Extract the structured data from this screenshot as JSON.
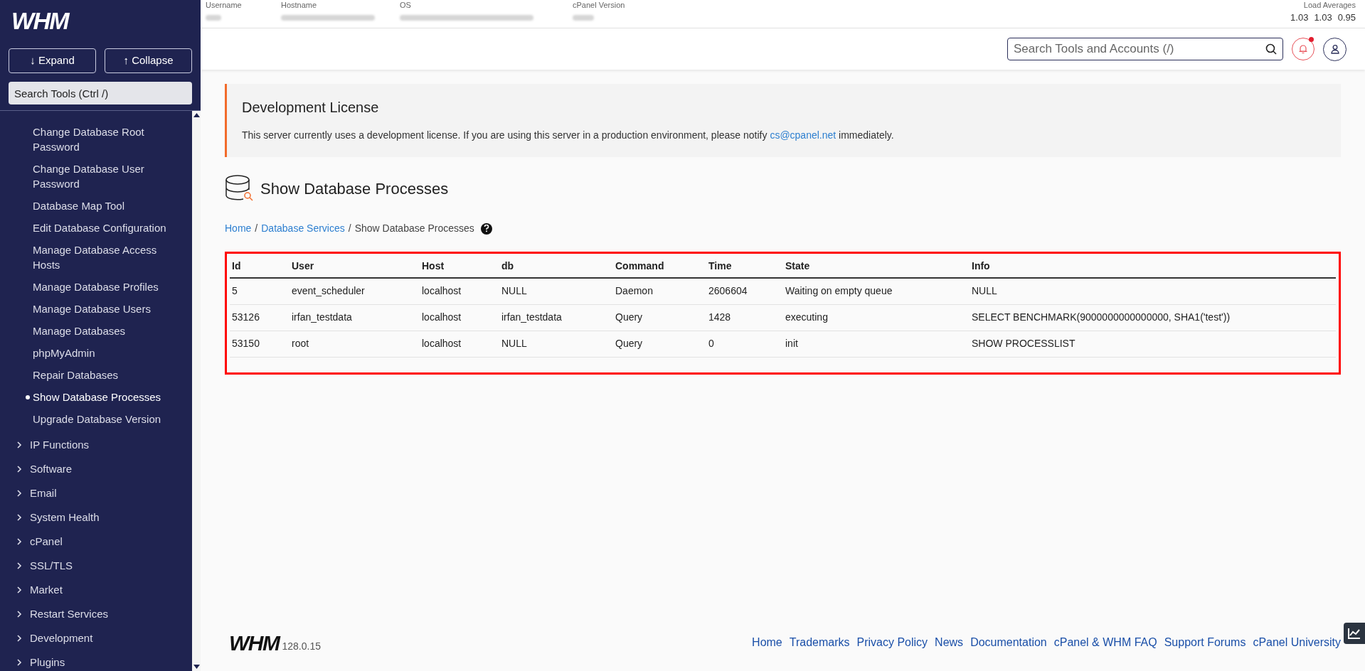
{
  "sidebar": {
    "logo": "WHM",
    "expand_button": "↓ Expand",
    "collapse_button": "↑ Collapse",
    "search": {
      "placeholder": "Search Tools (Ctrl /)"
    },
    "subitems": [
      {
        "label": "Change Database Root Password",
        "selected": false
      },
      {
        "label": "Change Database User Password",
        "selected": false
      },
      {
        "label": "Database Map Tool",
        "selected": false
      },
      {
        "label": "Edit Database Configuration",
        "selected": false
      },
      {
        "label": "Manage Database Access Hosts",
        "selected": false
      },
      {
        "label": "Manage Database Profiles",
        "selected": false
      },
      {
        "label": "Manage Database Users",
        "selected": false
      },
      {
        "label": "Manage Databases",
        "selected": false
      },
      {
        "label": "phpMyAdmin",
        "selected": false
      },
      {
        "label": "Repair Databases",
        "selected": false
      },
      {
        "label": "Show Database Processes",
        "selected": true
      },
      {
        "label": "Upgrade Database Version",
        "selected": false
      }
    ],
    "sections": [
      {
        "label": "IP Functions",
        "expanded": false
      },
      {
        "label": "Software",
        "expanded": false
      },
      {
        "label": "Email",
        "expanded": false
      },
      {
        "label": "System Health",
        "expanded": false
      },
      {
        "label": "cPanel",
        "expanded": false
      },
      {
        "label": "SSL/TLS",
        "expanded": false
      },
      {
        "label": "Market",
        "expanded": false
      },
      {
        "label": "Restart Services",
        "expanded": false
      },
      {
        "label": "Development",
        "expanded": false
      },
      {
        "label": "Plugins",
        "expanded": false
      }
    ]
  },
  "server_info": {
    "labels": [
      "Username",
      "Hostname",
      "OS",
      "cPanel Version"
    ],
    "load_averages_label": "Load Averages",
    "load_averages": [
      "1.03",
      "1.03",
      "0.95"
    ]
  },
  "top_search": {
    "placeholder": "Search Tools and Accounts (/)"
  },
  "notifications": {
    "unread": true
  },
  "alert": {
    "title": "Development License",
    "text_before": "This server currently uses a development license. If you are using this server in a production environment, please notify",
    "link": "cs@cpanel.net",
    "text_after": "immediately."
  },
  "page_title": "Show Database Processes",
  "breadcrumb": [
    {
      "label": "Home",
      "link": true,
      "separator": "/"
    },
    {
      "label": "Database Services",
      "link": true,
      "separator": "/"
    },
    {
      "label": "Show Database Processes",
      "link": false
    }
  ],
  "table": {
    "columns": [
      "Id",
      "User",
      "Host",
      "db",
      "Command",
      "Time",
      "State",
      "Info"
    ],
    "rows": [
      [
        "5",
        "event_scheduler",
        "localhost",
        "NULL",
        "Daemon",
        "2606604",
        "Waiting on empty queue",
        "NULL"
      ],
      [
        "53126",
        "irfan_testdata",
        "localhost",
        "irfan_testdata",
        "Query",
        "1428",
        "executing",
        "SELECT BENCHMARK(9000000000000000, SHA1('test'))"
      ],
      [
        "53150",
        "root",
        "localhost",
        "NULL",
        "Query",
        "0",
        "init",
        "SHOW PROCESSLIST"
      ]
    ]
  },
  "footer": {
    "logo": "WHM",
    "version": "128.0.15",
    "links": [
      "Home",
      "Trademarks",
      "Privacy Policy",
      "News",
      "Documentation",
      "cPanel & WHM FAQ",
      "Support Forums",
      "cPanel University"
    ]
  }
}
